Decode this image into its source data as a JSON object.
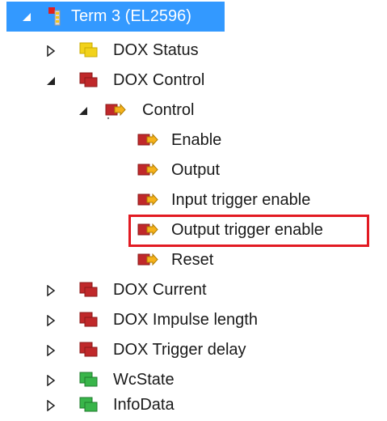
{
  "tree": {
    "root": {
      "label": "Term 3 (EL2596)"
    },
    "items": [
      {
        "label": "DOX Status",
        "icon": "input-yellow-icon",
        "state": "collapsed"
      },
      {
        "label": "DOX Control",
        "icon": "output-red-icon",
        "state": "expanded"
      },
      {
        "label": "Control",
        "icon": "output-variable-icon",
        "state": "expanded"
      },
      {
        "label": "Enable",
        "icon": "output-variable-icon"
      },
      {
        "label": "Output",
        "icon": "output-variable-icon"
      },
      {
        "label": "Input trigger enable",
        "icon": "output-variable-icon"
      },
      {
        "label": "Output trigger enable",
        "icon": "output-variable-icon",
        "highlighted": true
      },
      {
        "label": "Reset",
        "icon": "output-variable-icon"
      },
      {
        "label": "DOX Current",
        "icon": "output-red-icon",
        "state": "collapsed"
      },
      {
        "label": "DOX Impulse length",
        "icon": "output-red-icon",
        "state": "collapsed"
      },
      {
        "label": "DOX Trigger delay",
        "icon": "output-red-icon",
        "state": "collapsed"
      },
      {
        "label": "WcState",
        "icon": "input-green-icon",
        "state": "collapsed"
      },
      {
        "label": "InfoData",
        "icon": "input-green-icon",
        "state": "collapsed"
      }
    ]
  },
  "colors": {
    "selection": "#3399ff",
    "highlight_border": "#e21a22",
    "red_group": "#c0282a",
    "yellow_group": "#f2d21b",
    "green_group": "#39b54a",
    "variable_arrow": "#f5b21b"
  }
}
